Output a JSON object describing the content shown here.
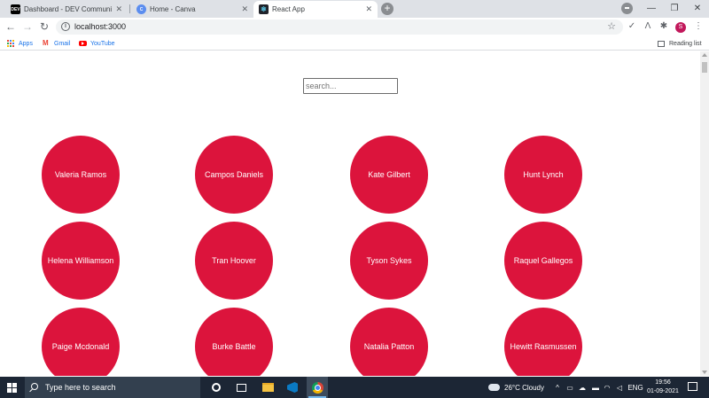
{
  "browser": {
    "tabs": [
      {
        "title": "Dashboard - DEV Community",
        "favicon": "dev-favicon",
        "active": false
      },
      {
        "title": "Home - Canva",
        "favicon": "canva-favicon",
        "active": false
      },
      {
        "title": "React App",
        "favicon": "react-favicon",
        "active": true
      }
    ],
    "url": "localhost:3000",
    "profile_initial": "S",
    "bookmarks": [
      {
        "label": "Apps",
        "icon": "apps-grid-icon"
      },
      {
        "label": "Gmail",
        "icon": "gmail-icon"
      },
      {
        "label": "YouTube",
        "icon": "youtube-icon"
      }
    ],
    "reading_list": "Reading list"
  },
  "page": {
    "search_placeholder": "search...",
    "card_color": "#dc143c",
    "robots": [
      "Valeria Ramos",
      "Campos Daniels",
      "Kate Gilbert",
      "Hunt Lynch",
      "Helena Williamson",
      "Tran Hoover",
      "Tyson Sykes",
      "Raquel Gallegos",
      "Paige Mcdonald",
      "Burke Battle",
      "Natalia Patton",
      "Hewitt Rasmussen"
    ]
  },
  "taskbar": {
    "search_text": "Type here to search",
    "weather": "26°C  Cloudy",
    "language": "ENG",
    "time": "19:56",
    "date": "01-09-2021"
  }
}
